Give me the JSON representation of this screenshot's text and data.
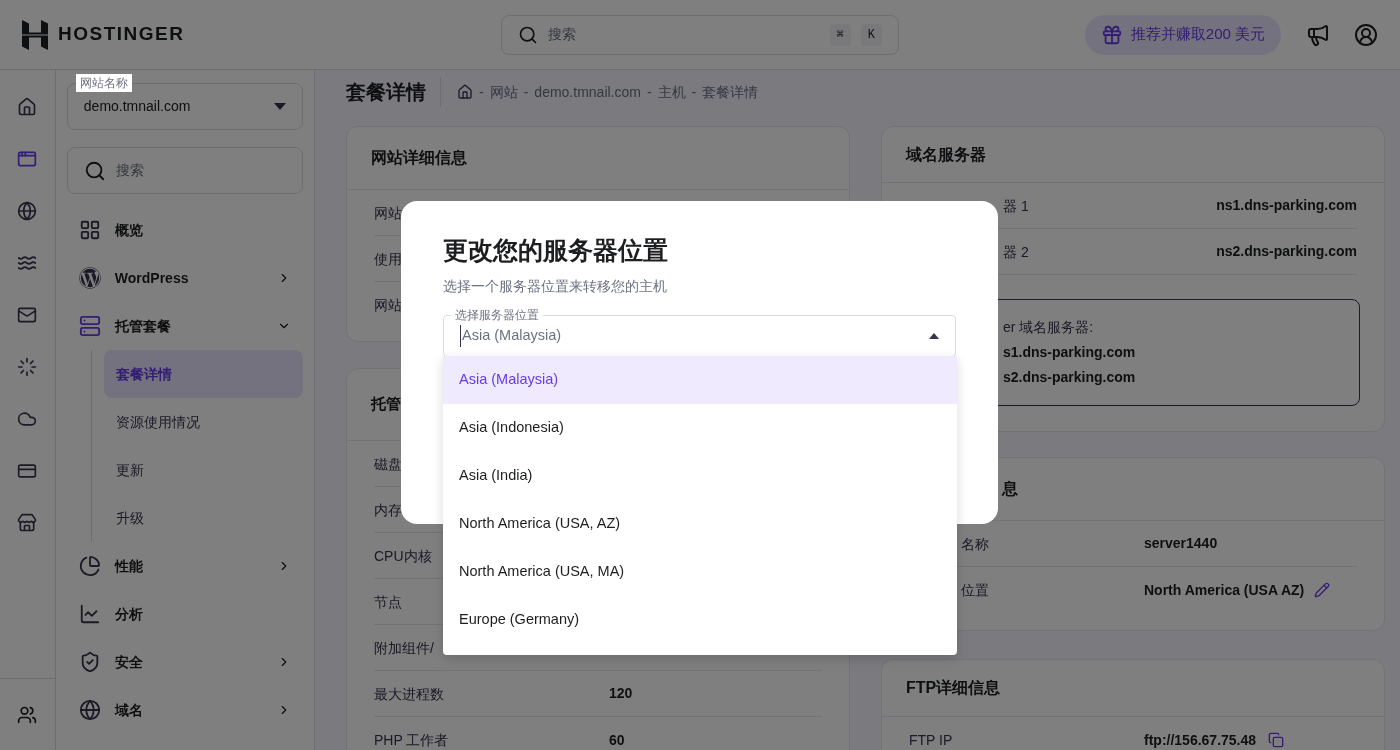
{
  "header": {
    "brand": "HOSTINGER",
    "search": {
      "placeholder": "搜索",
      "keys": [
        "⌘",
        "K"
      ]
    },
    "referral": "推荐并赚取200 美元"
  },
  "rail": [
    {
      "selected": false
    },
    {
      "selected": true
    },
    {
      "selected": false
    },
    {
      "selected": false
    },
    {
      "selected": false
    },
    {
      "selected": false
    },
    {
      "selected": false
    },
    {
      "selected": false
    },
    {
      "selected": false
    }
  ],
  "sidebar": {
    "site_select": {
      "label": "网站名称",
      "value": "demo.tmnail.com"
    },
    "search": {
      "placeholder": "搜索"
    },
    "items": [
      {
        "label": "概览",
        "selected": false
      },
      {
        "label": "WordPress",
        "selected": false,
        "expanded": false
      },
      {
        "label": "托管套餐",
        "selected": true,
        "expanded": true,
        "children": [
          {
            "label": "套餐详情",
            "selected": true
          },
          {
            "label": "资源使用情况",
            "selected": false
          },
          {
            "label": "更新",
            "selected": false
          },
          {
            "label": "升级",
            "selected": false
          }
        ]
      },
      {
        "label": "性能",
        "selected": false,
        "expanded": false
      },
      {
        "label": "分析",
        "selected": false
      },
      {
        "label": "安全",
        "selected": false,
        "expanded": false
      },
      {
        "label": "域名",
        "selected": false,
        "expanded": false
      }
    ]
  },
  "page": {
    "title": "套餐详情",
    "breadcrumb": [
      "网站",
      "demo.tmnail.com",
      "主机",
      "套餐详情"
    ],
    "separator": "-"
  },
  "website_card": {
    "title": "网站详细信息",
    "rows": [
      {
        "label": "网站"
      },
      {
        "label": "使用"
      },
      {
        "label": "网站"
      }
    ]
  },
  "hosting_card": {
    "title": "托管",
    "rows": [
      {
        "label": "磁盘"
      },
      {
        "label": "内存"
      },
      {
        "label": "CPU内核"
      },
      {
        "label": "节点"
      },
      {
        "label": "附加组件/"
      },
      {
        "label": "最大进程数",
        "value": "120"
      },
      {
        "label": "PHP 工作者",
        "value": "60"
      }
    ]
  },
  "nameserver_card": {
    "title": "域名服务器",
    "rows": [
      {
        "label": "器 1",
        "value": "ns1.dns-parking.com"
      },
      {
        "label": "器 2",
        "value": "ns2.dns-parking.com"
      }
    ],
    "note": {
      "heading": "er 域名服务器:",
      "lines": [
        "s1.dns-parking.com",
        "s2.dns-parking.com"
      ]
    }
  },
  "server_card": {
    "title": "息",
    "rows": [
      {
        "label": "名称",
        "value": "server1440"
      },
      {
        "label": "位置",
        "value": "North America (USA AZ)",
        "editable": true
      }
    ]
  },
  "ftp_card": {
    "title": "FTP详细信息",
    "rows": [
      {
        "label": "FTP IP",
        "value": "ftp://156.67.75.48"
      }
    ]
  },
  "modal": {
    "title": "更改您的服务器位置",
    "subtitle": "选择一个服务器位置来转移您的主机",
    "select": {
      "label": "选择服务器位置",
      "value": "Asia (Malaysia)",
      "expanded": true
    },
    "options": [
      {
        "label": "Asia (Malaysia)",
        "selected": true
      },
      {
        "label": "Asia (Indonesia)",
        "selected": false
      },
      {
        "label": "Asia (India)",
        "selected": false
      },
      {
        "label": "North America (USA, AZ)",
        "selected": false
      },
      {
        "label": "North America (USA, MA)",
        "selected": false
      },
      {
        "label": "Europe (Germany)",
        "selected": false
      }
    ]
  }
}
